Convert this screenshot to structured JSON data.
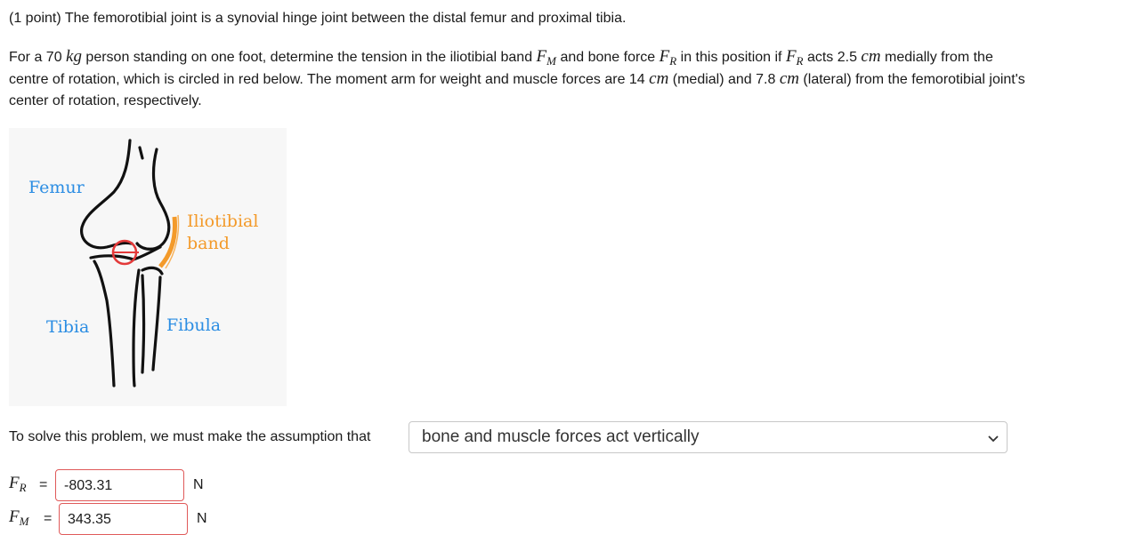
{
  "question": {
    "line1": "(1 point) The femorotibial joint is a synovial hinge joint between the distal femur and proximal tibia.",
    "p_a": "For a 70 ",
    "m_kg": "kg",
    "p_b": " person standing on one foot, determine the tension in the iliotibial band ",
    "m_fm_F": "F",
    "m_fm_sub": "M",
    "p_c": " and bone force ",
    "m_fr_F": "F",
    "m_fr_sub": "R",
    "p_d": " in this position if ",
    "m_fr2_F": "F",
    "m_fr2_sub": "R",
    "p_e": " acts 2.5 ",
    "m_cm1": "cm",
    "p_f": " medially from the",
    "line3_a": "centre of rotation, which is circled in red below. The moment arm for weight and muscle forces are 14 ",
    "m_cm2": "cm",
    "line3_b": " (medial) and 7.8 ",
    "m_cm3": "cm",
    "line3_c": " (lateral) from the femorotibial joint's",
    "line4": "center of rotation, respectively."
  },
  "figure": {
    "femur": "Femur",
    "iliotibial": "Iliotibial",
    "band": "band",
    "tibia": "Tibia",
    "fibula": "Fibula",
    "colors": {
      "femur": "#2b8de3",
      "iliotibial": "#f39a2a",
      "tibia": "#2b8de3",
      "fibula": "#2b8de3",
      "circle": "#e33a3a"
    }
  },
  "assumption": {
    "prompt": "To solve this problem, we must make the assumption that",
    "selected": "bone and muscle forces act vertically"
  },
  "answers": {
    "fr_label_F": "F",
    "fr_label_sub": "R",
    "fr_eq": "=",
    "fr_value": "-803.31",
    "fr_unit": "N",
    "fm_label_F": "F",
    "fm_label_sub": "M",
    "fm_eq": "=",
    "fm_value": "343.35",
    "fm_unit": "N"
  }
}
